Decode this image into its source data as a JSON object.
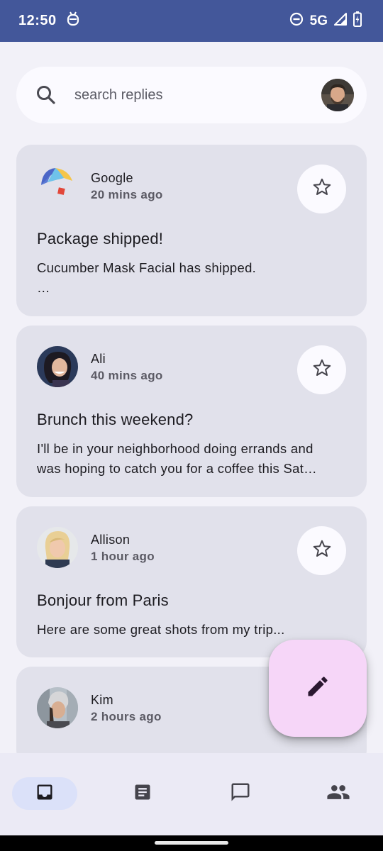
{
  "status_bar": {
    "time": "12:50",
    "network": "5G",
    "icons": [
      "notification-android-icon",
      "do-not-disturb-icon",
      "signal-icon",
      "battery-charging-icon"
    ]
  },
  "search": {
    "placeholder": "search replies",
    "icon": "search-icon"
  },
  "emails": [
    {
      "sender": "Google",
      "time": "20 mins ago",
      "subject": "Package shipped!",
      "preview_lines": [
        "Cucumber Mask Facial has shipped.",
        "…"
      ],
      "avatar": "google-logo"
    },
    {
      "sender": "Ali",
      "time": "40 mins ago",
      "subject": "Brunch this weekend?",
      "preview_lines": [
        "I'll be in your neighborhood doing errands and",
        "was hoping to catch you for a coffee this Sat…"
      ],
      "avatar": "ali-avatar"
    },
    {
      "sender": "Allison",
      "time": "1 hour ago",
      "subject": "Bonjour from Paris",
      "preview_lines": [
        "Here are some great shots from my trip..."
      ],
      "avatar": "allison-avatar"
    },
    {
      "sender": "Kim",
      "time": "2 hours ago",
      "subject": "",
      "preview_lines": [],
      "avatar": "kim-avatar"
    }
  ],
  "fab": {
    "icon": "edit-pencil-icon"
  },
  "bottom_nav": {
    "items": [
      {
        "name": "inbox",
        "icon": "inbox-icon",
        "active": true
      },
      {
        "name": "articles",
        "icon": "article-icon",
        "active": false
      },
      {
        "name": "messages",
        "icon": "chat-bubble-icon",
        "active": false
      },
      {
        "name": "groups",
        "icon": "people-icon",
        "active": false
      }
    ]
  },
  "colors": {
    "status_bar": "#43579a",
    "background": "#f2f1f8",
    "card": "#e1e1eb",
    "fab": "#f6d6f8",
    "nav_active": "#dbe1f9"
  }
}
